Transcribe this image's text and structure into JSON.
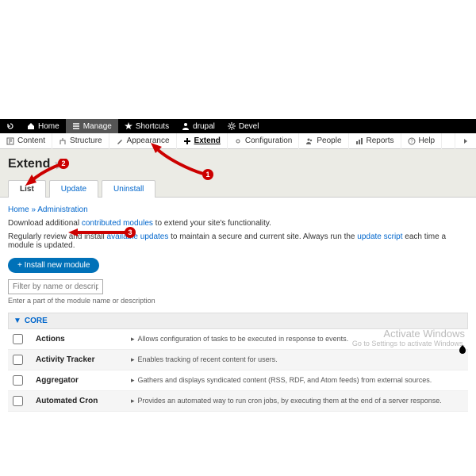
{
  "blackbar": {
    "back": "",
    "home": "Home",
    "manage": "Manage",
    "shortcuts": "Shortcuts",
    "user": "drupal",
    "devel": "Devel"
  },
  "admin_tabs": {
    "content": "Content",
    "structure": "Structure",
    "appearance": "Appearance",
    "extend": "Extend",
    "configuration": "Configuration",
    "people": "People",
    "reports": "Reports",
    "help": "Help"
  },
  "page_title": "Extend",
  "subtabs": {
    "list": "List",
    "update": "Update",
    "uninstall": "Uninstall"
  },
  "breadcrumb": {
    "home": "Home",
    "admin": "Administration"
  },
  "desc1_a": "Download additional ",
  "desc1_link": "contributed modules",
  "desc1_b": " to extend your site's functionality.",
  "desc2_a": "Regularly review and install ",
  "desc2_link1": "available updates",
  "desc2_b": " to maintain a secure and current site. Always run the ",
  "desc2_link2": "update script",
  "desc2_c": " each time a module is updated.",
  "install_btn": "+ Install new module",
  "filter_placeholder": "Filter by name or description",
  "filter_hint": "Enter a part of the module name or description",
  "section_core": "CORE",
  "modules": [
    {
      "name": "Actions",
      "desc": "Allows configuration of tasks to be executed in response to events."
    },
    {
      "name": "Activity Tracker",
      "desc": "Enables tracking of recent content for users."
    },
    {
      "name": "Aggregator",
      "desc": "Gathers and displays syndicated content (RSS, RDF, and Atom feeds) from external sources."
    },
    {
      "name": "Automated Cron",
      "desc": "Provides an automated way to run cron jobs, by executing them at the end of a server response."
    }
  ],
  "watermark": {
    "l1": "Activate Windows",
    "l2": "Go to Settings to activate Windows."
  },
  "annotations": {
    "a1": "1",
    "a2": "2",
    "a3": "3"
  }
}
